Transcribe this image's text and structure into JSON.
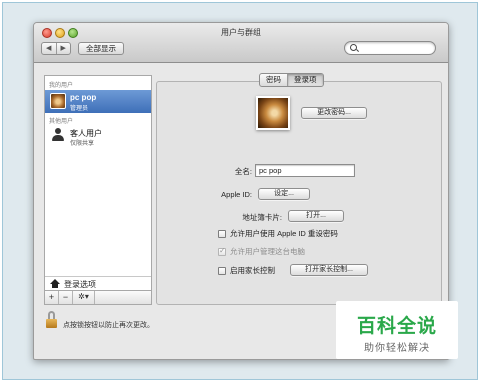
{
  "window": {
    "title": "用户与群组"
  },
  "toolbar": {
    "back_icon": "◀",
    "forward_icon": "▶",
    "show_all_label": "全部显示",
    "search_placeholder": ""
  },
  "sidebar": {
    "my_users_header": "我的用户",
    "current_user": {
      "name": "pc pop",
      "role": "管理员"
    },
    "other_users_header": "其他用户",
    "guest_user": {
      "name": "客人用户",
      "role": "仅限共享"
    },
    "login_options_label": "登录选项",
    "add_label": "+",
    "remove_label": "−",
    "gear_label": "✲▾"
  },
  "tabs": [
    {
      "label": "密码",
      "active": false
    },
    {
      "label": "登录项",
      "active": true
    }
  ],
  "detail": {
    "change_password_label": "更改密码...",
    "fullname_label": "全名:",
    "fullname_value": "pc pop",
    "appleid_label": "Apple ID:",
    "appleid_button": "设定...",
    "address_card_label": "地址簿卡片:",
    "open_button": "打开...",
    "checkbox_reset_with_appleid": "允许用户使用 Apple ID 重设密码",
    "checkbox_admin": "允许用户管理这台电脑",
    "checkbox_parental": "启用家长控制",
    "open_parental_button": "打开家长控制..."
  },
  "lock": {
    "text": "点按锁按钮以防止再次更改。"
  },
  "watermark": {
    "main": "百科全说",
    "sub": "助你轻松解决"
  }
}
